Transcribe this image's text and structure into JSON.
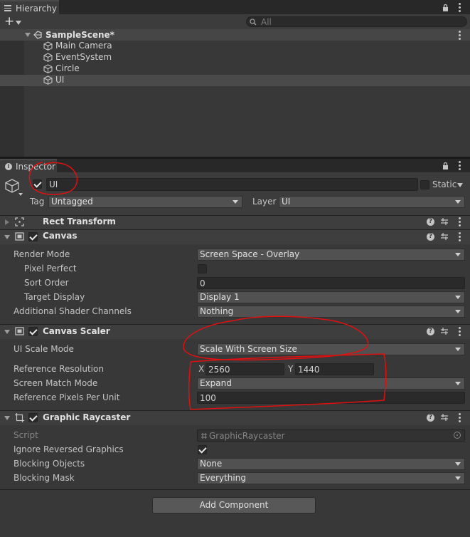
{
  "hierarchy": {
    "tab_label": "Hierarchy",
    "search_placeholder": "All",
    "scene_name": "SampleScene*",
    "items": [
      {
        "label": "Main Camera"
      },
      {
        "label": "EventSystem"
      },
      {
        "label": "Circle"
      },
      {
        "label": "UI"
      }
    ]
  },
  "inspector": {
    "tab_label": "Inspector",
    "object_name": "UI",
    "static_label": "Static",
    "tag_label": "Tag",
    "tag_value": "Untagged",
    "layer_label": "Layer",
    "layer_value": "UI"
  },
  "components": {
    "rect_transform": {
      "title": "Rect Transform"
    },
    "canvas": {
      "title": "Canvas",
      "fields": {
        "render_mode": {
          "label": "Render Mode",
          "value": "Screen Space - Overlay"
        },
        "pixel_perfect": {
          "label": "Pixel Perfect"
        },
        "sort_order": {
          "label": "Sort Order",
          "value": "0"
        },
        "target_display": {
          "label": "Target Display",
          "value": "Display 1"
        },
        "shader_channels": {
          "label": "Additional Shader Channels",
          "value": "Nothing"
        }
      }
    },
    "canvas_scaler": {
      "title": "Canvas Scaler",
      "fields": {
        "ui_scale_mode": {
          "label": "UI Scale Mode",
          "value": "Scale With Screen Size"
        },
        "reference_resolution": {
          "label": "Reference Resolution",
          "x_label": "X",
          "x_value": "2560",
          "y_label": "Y",
          "y_value": "1440"
        },
        "screen_match_mode": {
          "label": "Screen Match Mode",
          "value": "Expand"
        },
        "ref_pixels_per_unit": {
          "label": "Reference Pixels Per Unit",
          "value": "100"
        }
      }
    },
    "graphic_raycaster": {
      "title": "Graphic Raycaster",
      "fields": {
        "script": {
          "label": "Script",
          "value": "GraphicRaycaster"
        },
        "ignore_reversed": {
          "label": "Ignore Reversed Graphics"
        },
        "blocking_objects": {
          "label": "Blocking Objects",
          "value": "None"
        },
        "blocking_mask": {
          "label": "Blocking Mask",
          "value": "Everything"
        }
      }
    }
  },
  "add_component_label": "Add Component",
  "colors": {
    "panel_bg": "#383838",
    "field_bg": "#2a2a2a",
    "annotation_red": "#e01010",
    "selection_bg": "#4a4a4a"
  }
}
